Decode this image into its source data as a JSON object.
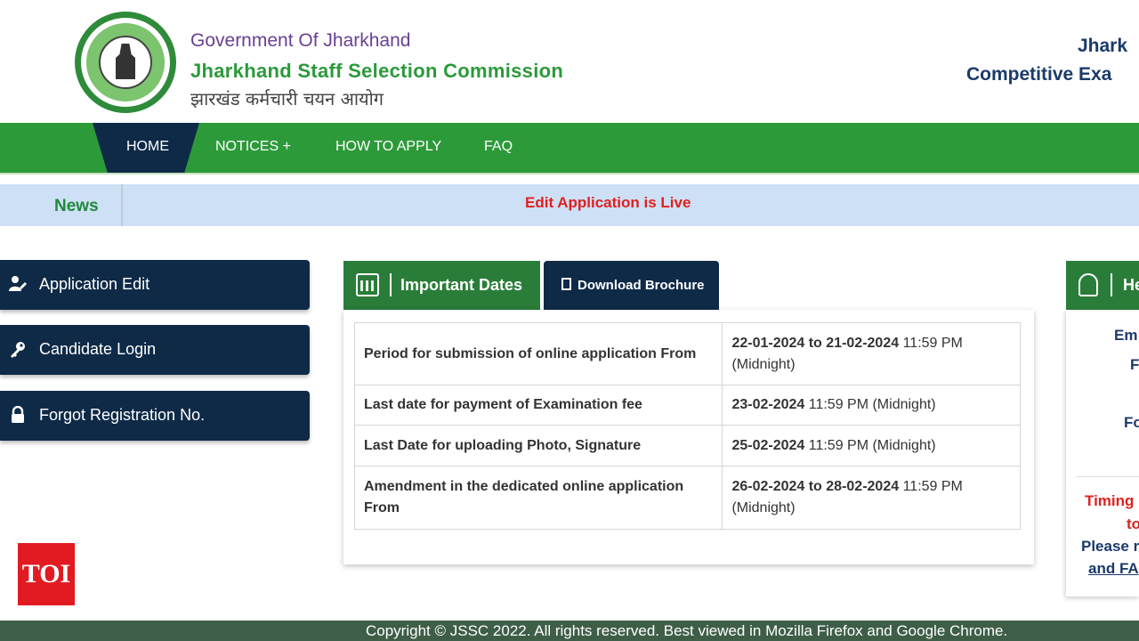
{
  "header": {
    "government": "Government Of Jharkhand",
    "organization": "Jharkhand Staff Selection Commission",
    "organization_hindi": "झारखंड कर्मचारी चयन आयोग",
    "right_title_line1": "Jhark",
    "right_title_line2": "Competitive Exa"
  },
  "nav": {
    "items": [
      {
        "label": "HOME"
      },
      {
        "label": "NOTICES +"
      },
      {
        "label": "HOW TO APPLY"
      },
      {
        "label": "FAQ"
      }
    ]
  },
  "news": {
    "label": "News",
    "ticker": "Edit Application is Live"
  },
  "sidebar": {
    "items": [
      {
        "label": "Application Edit",
        "icon": "user-edit-icon"
      },
      {
        "label": "Candidate Login",
        "icon": "key-icon"
      },
      {
        "label": "Forgot Registration No.",
        "icon": "lock-icon"
      }
    ]
  },
  "tabs": {
    "important_dates": "Important Dates",
    "download_brochure": "Download Brochure"
  },
  "important_dates": {
    "rows": [
      {
        "event": "Period for submission of online application From",
        "date": "22-01-2024 to 21-02-2024",
        "time": "11:59 PM (Midnight)"
      },
      {
        "event": "Last date for payment of Examination fee",
        "date": "23-02-2024",
        "time": "11:59 PM (Midnight)"
      },
      {
        "event": "Last Date for uploading Photo, Signature",
        "date": "25-02-2024",
        "time": "11:59 PM (Midnight)"
      },
      {
        "event": "Amendment in the dedicated online application From",
        "date": "26-02-2024 to 28-02-2024",
        "time": "11:59 PM (Midnight)"
      }
    ]
  },
  "right_panel": {
    "tab_label": "He",
    "line_em": "Em",
    "line_f": "F",
    "line_fo": "Fo",
    "timing": "Timing",
    "timing2": "to",
    "please": "Please r",
    "and_fa": "and FA"
  },
  "watermark": "TOI",
  "footer": {
    "text": "Copyright © JSSC 2022. All rights reserved. Best viewed in Mozilla Firefox and Google Chrome."
  },
  "colors": {
    "green": "#2d9a3a",
    "navy": "#0e2a47",
    "news_bg": "#cde0f5",
    "alert_red": "#e0201e"
  }
}
